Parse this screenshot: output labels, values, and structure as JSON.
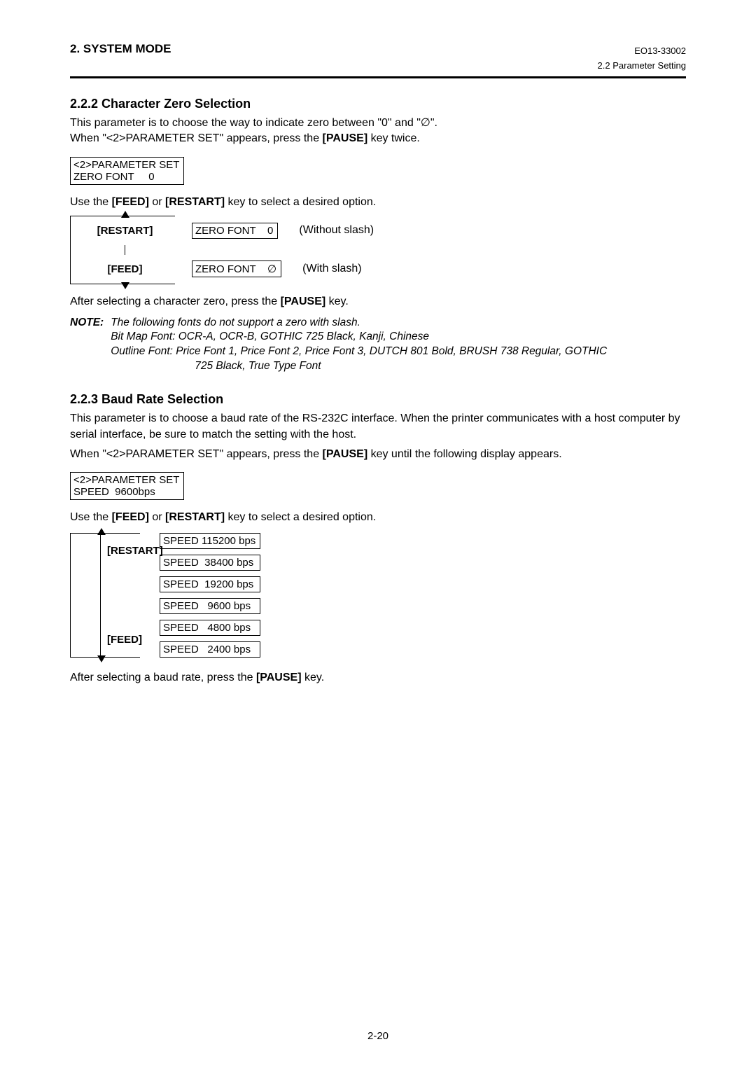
{
  "header": {
    "section": "2. SYSTEM MODE",
    "docnum": "EO13-33002",
    "subhead": "2.2 Parameter Setting"
  },
  "sec1": {
    "heading": "2.2.2  Character Zero Selection",
    "p1a": "This parameter is to choose the way to indicate zero between \"0\" and \"",
    "zero_slash": "∅",
    "p1b": "\".",
    "p2a": "When \"<2>PARAMETER SET\" appears, press the ",
    "pause": "[PAUSE]",
    "p2b": " key twice.",
    "lcd1_l1": "<2>PARAMETER SET",
    "lcd1_l2": "ZERO FONT     0",
    "p3a": "Use the ",
    "feed": "[FEED]",
    "or": " or ",
    "restart": "[RESTART]",
    "p3b": " key to select a desired option.",
    "opt1": {
      "box": "ZERO FONT    0",
      "desc": "(Without slash)"
    },
    "opt2": {
      "box": "ZERO FONT    ∅",
      "desc": "(With slash)"
    },
    "p4a": "After selecting a character zero, press the ",
    "p4b": " key.",
    "note_label": "NOTE:",
    "note_line1": "The following fonts do not support a zero with slash.",
    "note_line2": "Bit Map Font:  OCR-A, OCR-B, GOTHIC 725 Black, Kanji, Chinese",
    "note_line3": "Outline Font:  Price Font 1, Price Font 2, Price Font 3, DUTCH 801 Bold, BRUSH 738 Regular, GOTHIC",
    "note_line3b": "725 Black, True Type Font"
  },
  "sec2": {
    "heading": "2.2.3  Baud Rate Selection",
    "p1": "This parameter is to choose a baud rate of the RS-232C interface.  When the printer communicates with a host computer by serial interface, be sure to match the setting with the host.",
    "p2a": "When \"<2>PARAMETER SET\" appears, press the ",
    "pause": "[PAUSE]",
    "p2b": " key until the following display appears.",
    "lcd1_l1": "<2>PARAMETER SET",
    "lcd1_l2": "SPEED  9600bps",
    "p3a": "Use the ",
    "feed": "[FEED]",
    "or": " or ",
    "restart": "[RESTART]",
    "p3b": " key to select a desired option.",
    "speeds": [
      "SPEED 115200 bps",
      "SPEED  38400 bps",
      "SPEED  19200 bps",
      "SPEED   9600 bps",
      "SPEED   4800 bps",
      "SPEED   2400 bps"
    ],
    "p4a": "After selecting a baud rate, press the ",
    "p4b": " key."
  },
  "keys": {
    "restart": "[RESTART]",
    "feed": "[FEED]"
  },
  "footer": {
    "pagenum": "2-20"
  }
}
